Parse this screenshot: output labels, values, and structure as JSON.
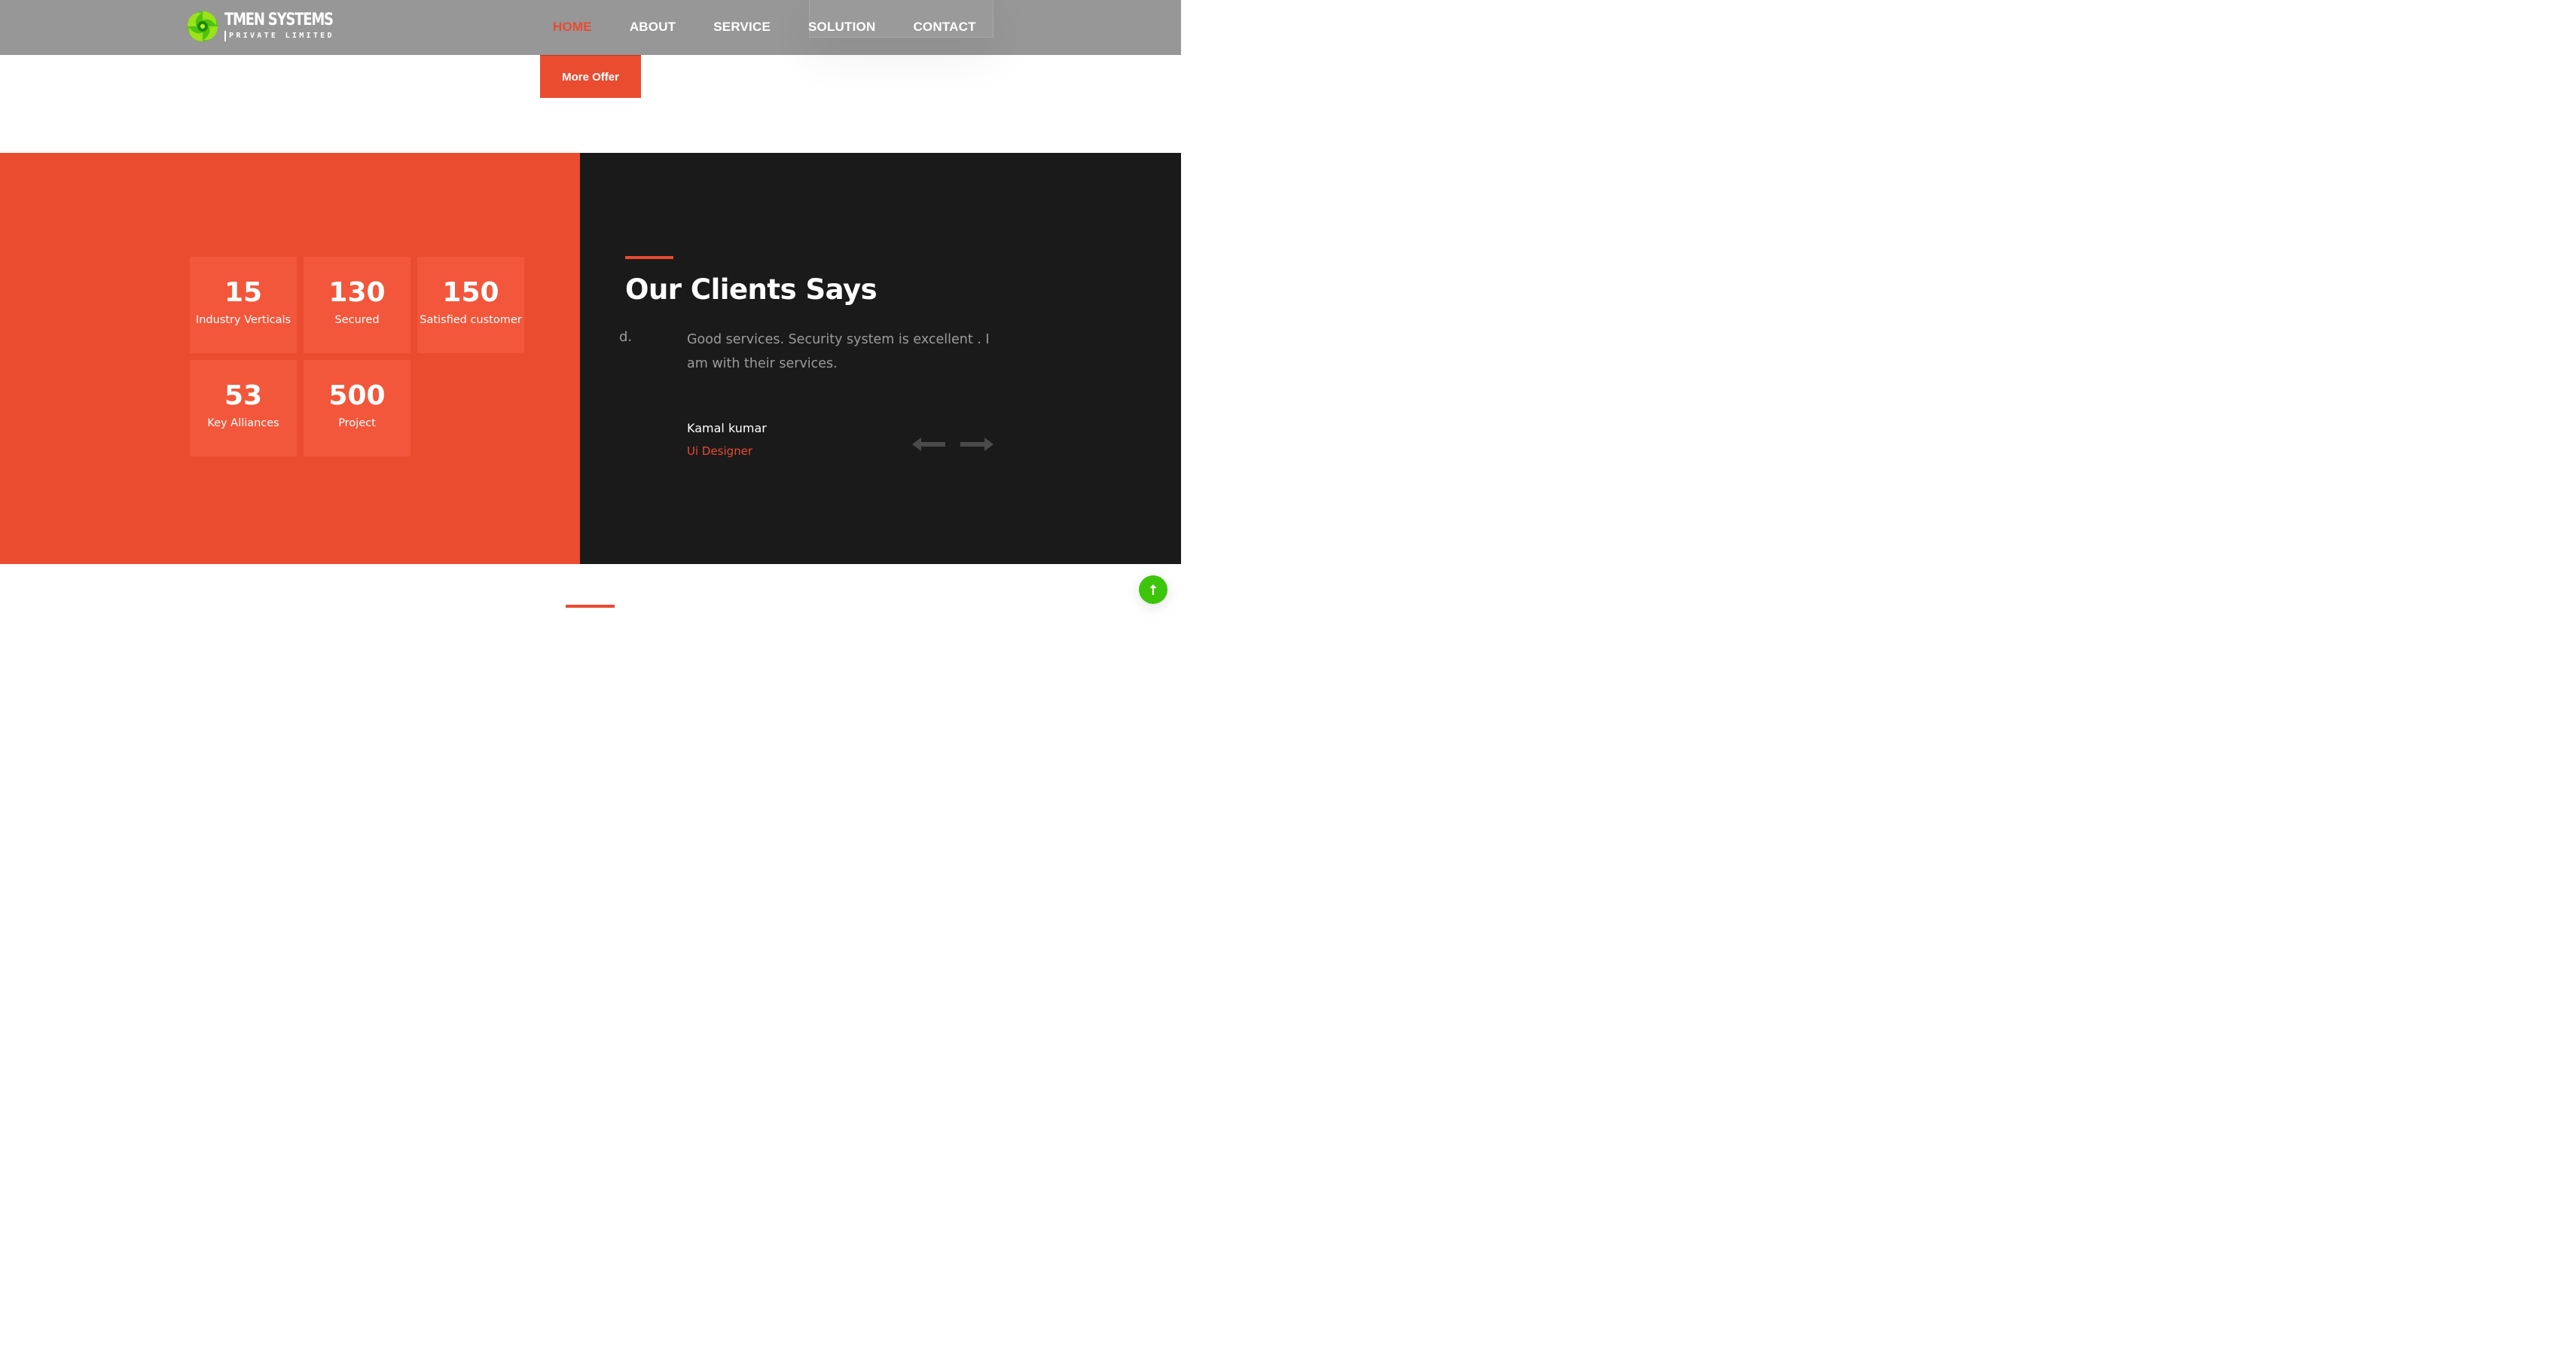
{
  "header": {
    "logo": {
      "title": "TMEN SYSTEMS",
      "subtitle": "PRIVATE LIMITED",
      "icon": "swirl-logo-icon",
      "colors": [
        "#7ad10b",
        "#3cc50b"
      ]
    },
    "nav": [
      {
        "label": "HOME",
        "active": true
      },
      {
        "label": "ABOUT",
        "active": false
      },
      {
        "label": "SERVICE",
        "active": false
      },
      {
        "label": "SOLUTION",
        "active": false
      },
      {
        "label": "CONTACT",
        "active": false
      }
    ]
  },
  "offer": {
    "button_label": "More Offer"
  },
  "stats": [
    {
      "value": "15",
      "label": "Industry Verticals"
    },
    {
      "value": "130",
      "label": "Secured"
    },
    {
      "value": "150",
      "label": "Satisfied customer"
    },
    {
      "value": "53",
      "label": "Key Alliances"
    },
    {
      "value": "500",
      "label": "Project"
    }
  ],
  "testimonials": {
    "heading_regular": "Our Clients ",
    "heading_bold": "Says",
    "prev_fragment": "d.",
    "quote": "Good services. Security system is excellent . I am with their services.",
    "name": "Kamal kumar",
    "role": "Ui Designer",
    "prev_icon": "arrow-left-icon",
    "next_icon": "arrow-right-icon"
  },
  "scroll_top": {
    "icon": "arrow-up-icon"
  },
  "colors": {
    "accent": "#ea4c2f",
    "card": "#f2573b",
    "dark": "#1a1a1a",
    "header": "#979797",
    "green": "#3cc50b"
  }
}
